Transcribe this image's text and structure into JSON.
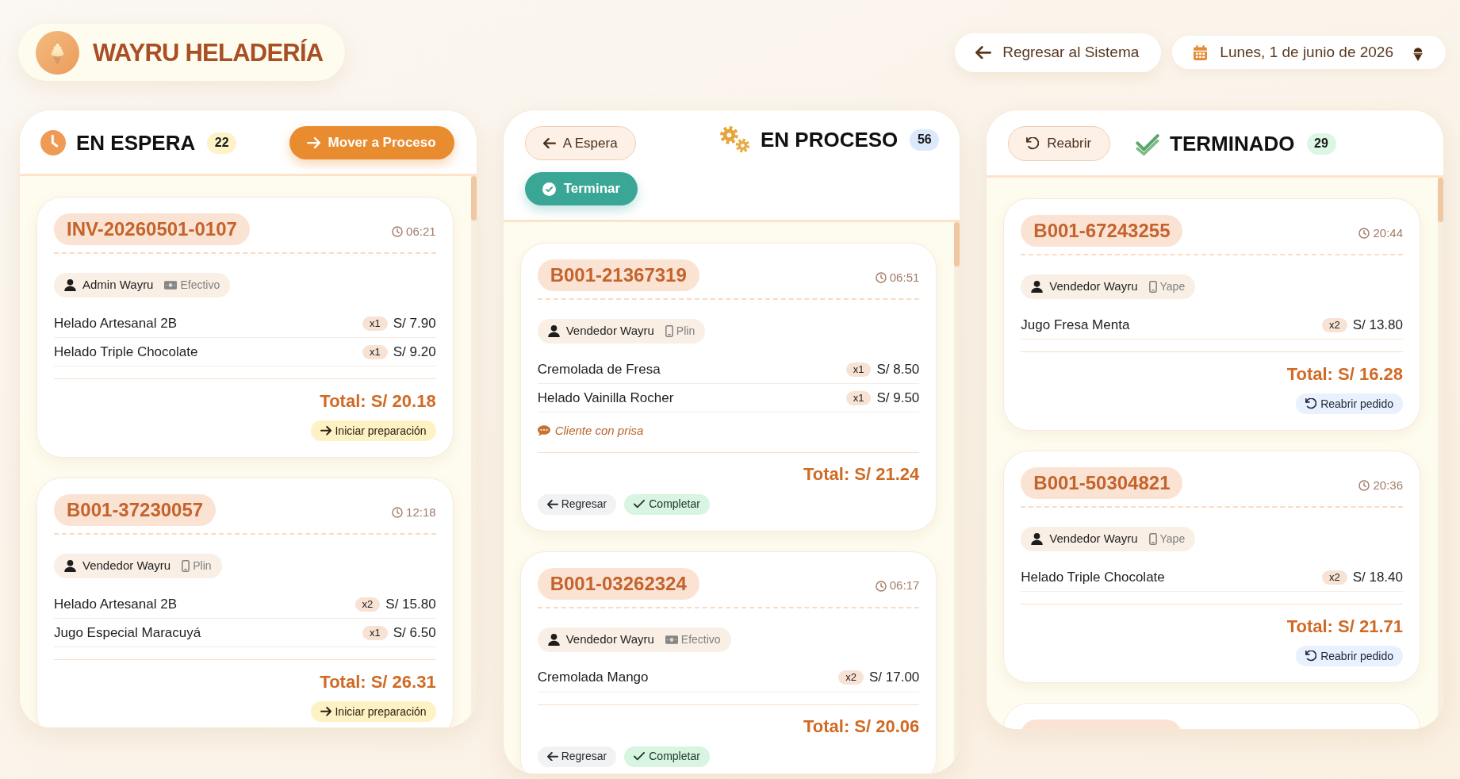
{
  "brand": {
    "title": "WAYRU HELADERÍA"
  },
  "toolbar": {
    "back_button": "Regresar al Sistema",
    "date": "Lunes, 1 de junio de 2026"
  },
  "columns": [
    {
      "kind": "waiting",
      "title": "EN ESPERA",
      "count": "22",
      "actions": [
        {
          "kind": "forward",
          "label": "Mover a Proceso"
        }
      ],
      "orders": [
        {
          "kind": "full",
          "id": "INV-20260501-0107",
          "time": "06:21",
          "seller": "Admin Wayru",
          "payment": {
            "kind": "cash",
            "label": "Efectivo"
          },
          "items": [
            {
              "name": "Helado Artesanal 2B",
              "qty": "x1",
              "price": "S/ 7.90"
            },
            {
              "name": "Helado Triple Chocolate",
              "qty": "x1",
              "price": "S/ 9.20"
            }
          ],
          "total": "Total: S/ 20.18",
          "actions": [
            {
              "kind": "start",
              "label": "Iniciar preparación"
            }
          ]
        },
        {
          "kind": "full",
          "id": "B001-37230057",
          "time": "12:18",
          "seller": "Vendedor Wayru",
          "payment": {
            "kind": "mobile",
            "label": "Plin"
          },
          "items": [
            {
              "name": "Helado Artesanal 2B",
              "qty": "x2",
              "price": "S/ 15.80"
            },
            {
              "name": "Jugo Especial Maracuyá",
              "qty": "x1",
              "price": "S/ 6.50"
            }
          ],
          "total": "Total: S/ 26.31",
          "actions": [
            {
              "kind": "start",
              "label": "Iniciar preparación"
            }
          ]
        }
      ]
    },
    {
      "kind": "in_progress",
      "title": "EN PROCESO",
      "count": "56",
      "actions": [
        {
          "kind": "back",
          "label": "A Espera"
        },
        {
          "kind": "finish",
          "label": "Terminar"
        }
      ],
      "orders": [
        {
          "kind": "full",
          "id": "B001-21367319",
          "time": "06:51",
          "seller": "Vendedor Wayru",
          "payment": {
            "kind": "mobile",
            "label": "Plin"
          },
          "items": [
            {
              "name": "Cremolada de Fresa",
              "qty": "x1",
              "price": "S/ 8.50"
            },
            {
              "name": "Helado Vainilla Rocher",
              "qty": "x1",
              "price": "S/ 9.50"
            }
          ],
          "note": "Cliente con prisa",
          "total": "Total: S/ 21.24",
          "actions": [
            {
              "kind": "back",
              "label": "Regresar"
            },
            {
              "kind": "complete",
              "label": "Completar"
            }
          ]
        },
        {
          "kind": "full",
          "id": "B001-03262324",
          "time": "06:17",
          "seller": "Vendedor Wayru",
          "payment": {
            "kind": "cash",
            "label": "Efectivo"
          },
          "items": [
            {
              "name": "Cremolada Mango",
              "qty": "x2",
              "price": "S/ 17.00"
            }
          ],
          "total": "Total: S/ 20.06",
          "actions": [
            {
              "kind": "back",
              "label": "Regresar"
            },
            {
              "kind": "complete",
              "label": "Completar"
            }
          ]
        }
      ]
    },
    {
      "kind": "done",
      "title": "TERMINADO",
      "count": "29",
      "actions": [
        {
          "kind": "reopen",
          "label": "Reabrir"
        }
      ],
      "orders": [
        {
          "kind": "full",
          "id": "B001-67243255",
          "time": "20:44",
          "seller": "Vendedor Wayru",
          "payment": {
            "kind": "mobile",
            "label": "Yape"
          },
          "items": [
            {
              "name": "Jugo Fresa Menta",
              "qty": "x2",
              "price": "S/ 13.80"
            }
          ],
          "total": "Total: S/ 16.28",
          "actions": [
            {
              "kind": "reopen",
              "label": "Reabrir pedido"
            }
          ]
        },
        {
          "kind": "full",
          "id": "B001-50304821",
          "time": "20:36",
          "seller": "Vendedor Wayru",
          "payment": {
            "kind": "mobile",
            "label": "Yape"
          },
          "items": [
            {
              "name": "Helado Triple Chocolate",
              "qty": "x2",
              "price": "S/ 18.40"
            }
          ],
          "total": "Total: S/ 21.71",
          "actions": [
            {
              "kind": "reopen",
              "label": "Reabrir pedido"
            }
          ]
        },
        {
          "kind": "partial"
        }
      ]
    }
  ]
}
